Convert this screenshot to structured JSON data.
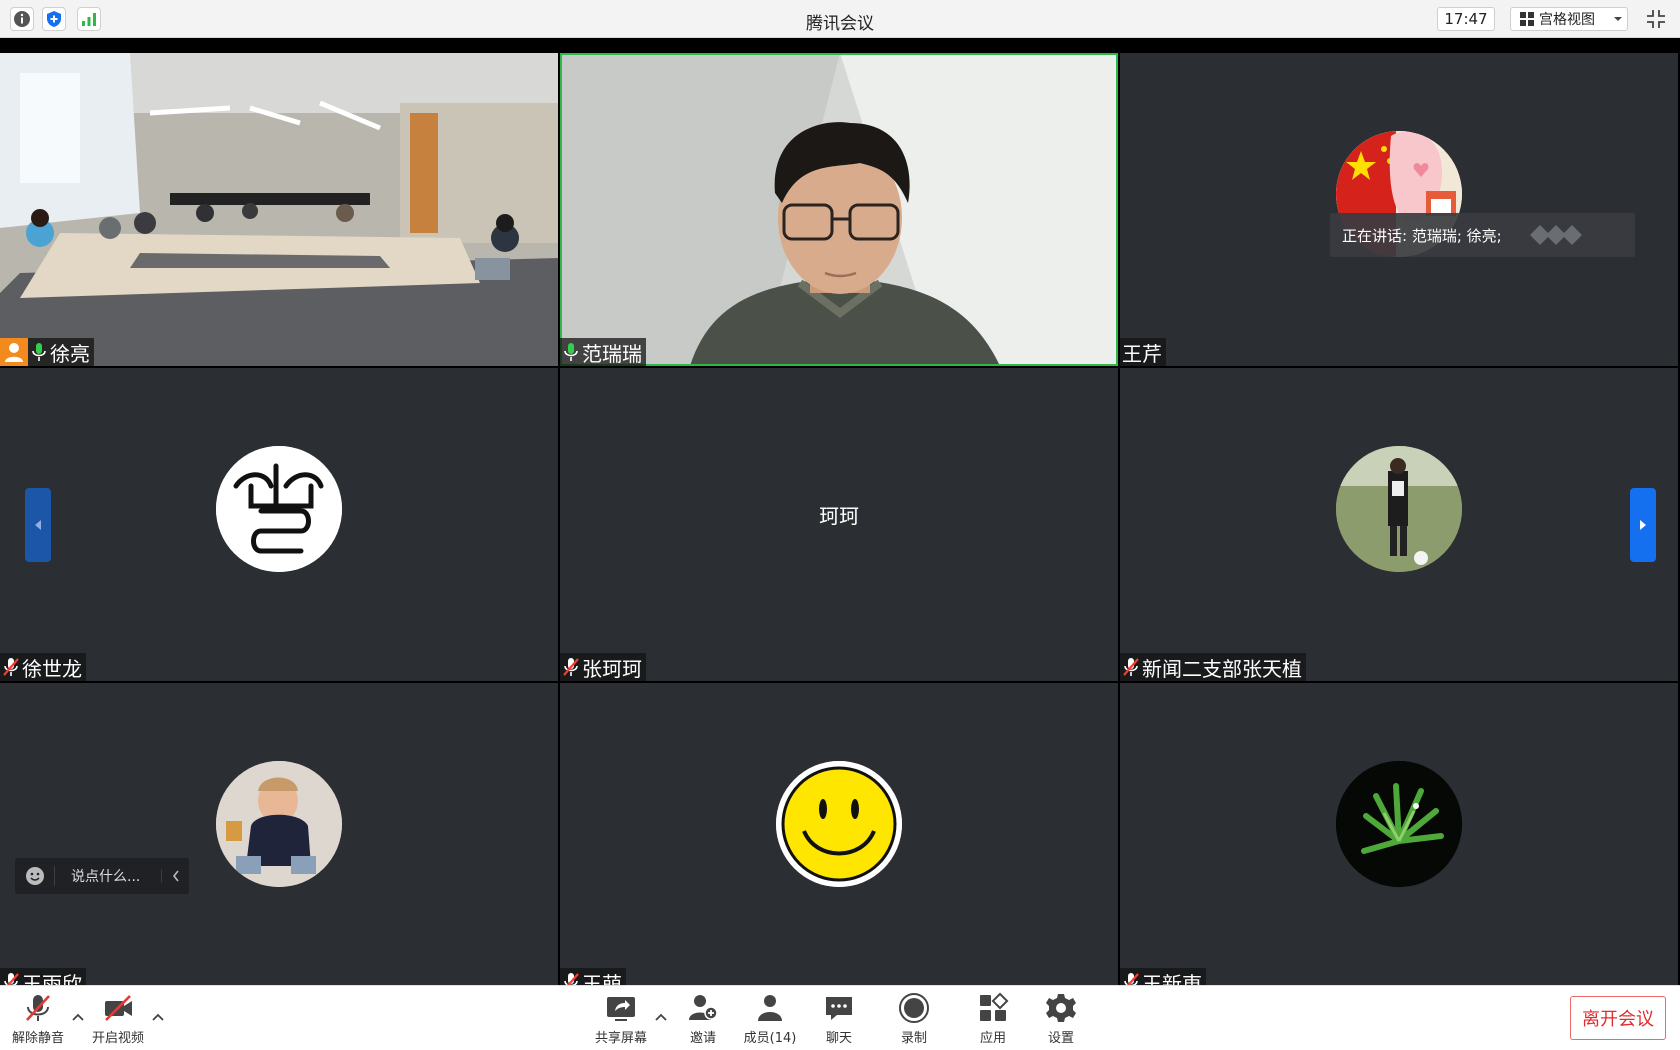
{
  "window": {
    "title": "腾讯会议",
    "time": "17:47",
    "view_mode": "宫格视图"
  },
  "speaking": {
    "text": "正在讲话: 范瑞瑞; 徐亮;"
  },
  "tiles": [
    {
      "name": "徐亮",
      "type": "video-room"
    },
    {
      "name": "范瑞瑞",
      "type": "video-person"
    },
    {
      "name": "王芹",
      "type": "avatar"
    },
    {
      "name": "徐世龙",
      "type": "avatar"
    },
    {
      "name": "张珂珂",
      "type": "text",
      "center_text": "珂珂"
    },
    {
      "name": "新闻二支部张天植",
      "type": "avatar"
    },
    {
      "name": "王雨欣",
      "type": "avatar"
    },
    {
      "name": "王萌",
      "type": "avatar"
    },
    {
      "name": "王新東",
      "type": "avatar"
    }
  ],
  "chat": {
    "placeholder": "说点什么..."
  },
  "toolbar": {
    "unmute": "解除静音",
    "start_video": "开启视频",
    "share_screen": "共享屏幕",
    "invite": "邀请",
    "members": "成员(14)",
    "chat": "聊天",
    "record": "录制",
    "apps": "应用",
    "settings": "设置",
    "leave": "离开会议"
  },
  "colors": {
    "accent_blue": "#1570ef",
    "leave_red": "#e02d2d",
    "active_border": "#2fb84a",
    "tile_bg": "#2b2e32"
  }
}
